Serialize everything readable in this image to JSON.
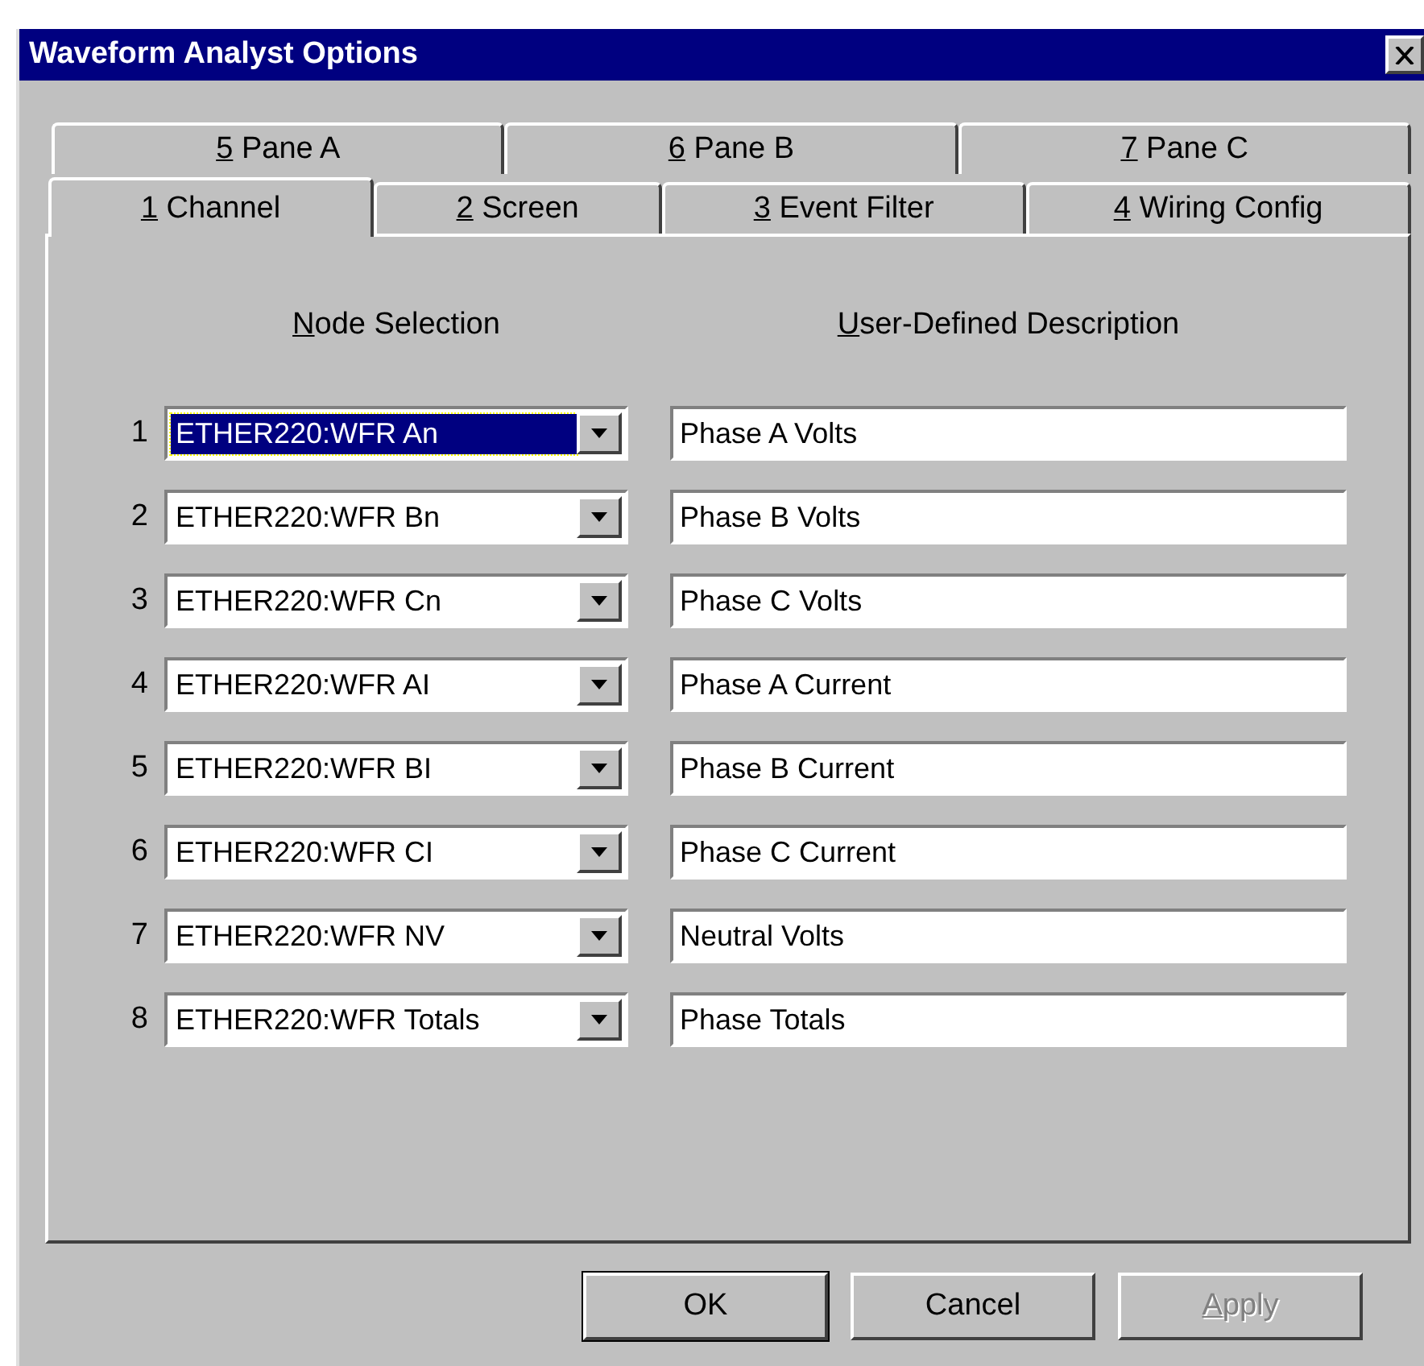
{
  "window": {
    "title": "Waveform Analyst Options"
  },
  "tab_rows": [
    [
      {
        "key": "5",
        "rest": " Pane A",
        "selected": false
      },
      {
        "key": "6",
        "rest": " Pane B",
        "selected": false
      },
      {
        "key": "7",
        "rest": " Pane C",
        "selected": false
      }
    ],
    [
      {
        "key": "1",
        "rest": " Channel",
        "selected": true
      },
      {
        "key": "2",
        "rest": " Screen",
        "selected": false
      },
      {
        "key": "3",
        "rest": " Event Filter",
        "selected": false
      },
      {
        "key": "4",
        "rest": " Wiring Config",
        "selected": false
      }
    ]
  ],
  "columns": [
    {
      "key": "N",
      "rest": "ode Selection"
    },
    {
      "key": "U",
      "rest": "ser-Defined Description"
    }
  ],
  "channels": [
    {
      "number": "1",
      "node": "ETHER220:WFR An",
      "description": "Phase A Volts",
      "selected": true
    },
    {
      "number": "2",
      "node": "ETHER220:WFR Bn",
      "description": "Phase B Volts",
      "selected": false
    },
    {
      "number": "3",
      "node": "ETHER220:WFR Cn",
      "description": "Phase C Volts",
      "selected": false
    },
    {
      "number": "4",
      "node": "ETHER220:WFR AI",
      "description": "Phase A Current",
      "selected": false
    },
    {
      "number": "5",
      "node": "ETHER220:WFR BI",
      "description": "Phase B Current",
      "selected": false
    },
    {
      "number": "6",
      "node": "ETHER220:WFR CI",
      "description": "Phase C Current",
      "selected": false
    },
    {
      "number": "7",
      "node": "ETHER220:WFR NV",
      "description": "Neutral Volts",
      "selected": false
    },
    {
      "number": "8",
      "node": "ETHER220:WFR Totals",
      "description": "Phase Totals",
      "selected": false
    }
  ],
  "buttons": [
    {
      "rest": "OK",
      "disabled": false,
      "default": true
    },
    {
      "rest": "Cancel",
      "disabled": false,
      "default": false
    },
    {
      "key": "A",
      "rest": "pply",
      "disabled": true,
      "default": false
    }
  ]
}
